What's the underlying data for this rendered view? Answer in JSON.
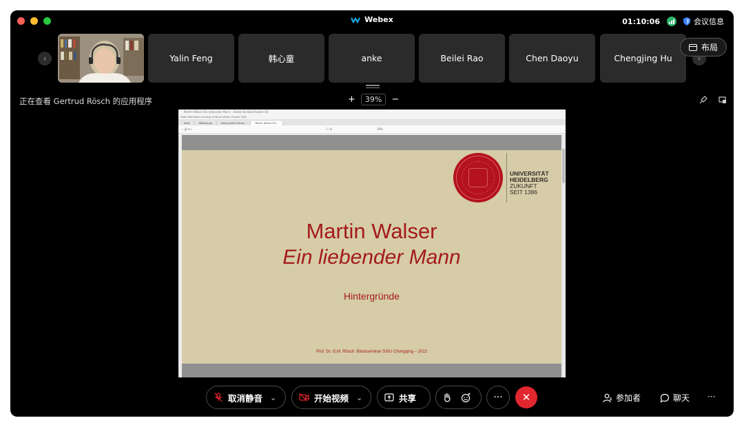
{
  "window": {
    "title": "Webex",
    "timer": "01:10:06",
    "meeting_info": "会议信息"
  },
  "participants": [
    {
      "name": "Yalin Feng"
    },
    {
      "name": "韩心童"
    },
    {
      "name": "anke"
    },
    {
      "name": "Beilei Rao"
    },
    {
      "name": "Chen Daoyu"
    },
    {
      "name": "Chengjing Hu"
    }
  ],
  "layout_button": "布局",
  "share": {
    "viewing_label": "正在查看 Gertrud Rösch 的应用程序",
    "zoom": "39%"
  },
  "acrobat": {
    "title": "Martin Walser Ein liebender Mann - Adobe Acrobat Reader DC",
    "menu": "Datei   Bearbeiten   Anzeige   Unterschreiben   Fenster   Hilfe",
    "tabs": [
      "Start",
      "Werkzeuge",
      "Nanny Josef Ortner...",
      "Martin Walser Ein..."
    ],
    "page": "1 / 8",
    "zoom": "39%"
  },
  "slide": {
    "university_lines": [
      "UNIVERSITÄT",
      "HEIDELBERG",
      "ZUKUNFT",
      "SEIT 1386"
    ],
    "title": "Martin Walser",
    "subtitle": "Ein liebender Mann",
    "heading": "Hintergründe",
    "footer": "Prof. Dr. G.M. Rösch: Blockseminar SISU Chongqing – 2022"
  },
  "controls": {
    "unmute": "取消静音",
    "start_video": "开始视频",
    "share": "共享",
    "more": "···",
    "participants": "参加者",
    "chat": "聊天",
    "overflow": "···"
  },
  "colors": {
    "accent_red": "#e0262f",
    "slide_bg": "#d6cca8",
    "slide_text": "#a31a1a"
  }
}
